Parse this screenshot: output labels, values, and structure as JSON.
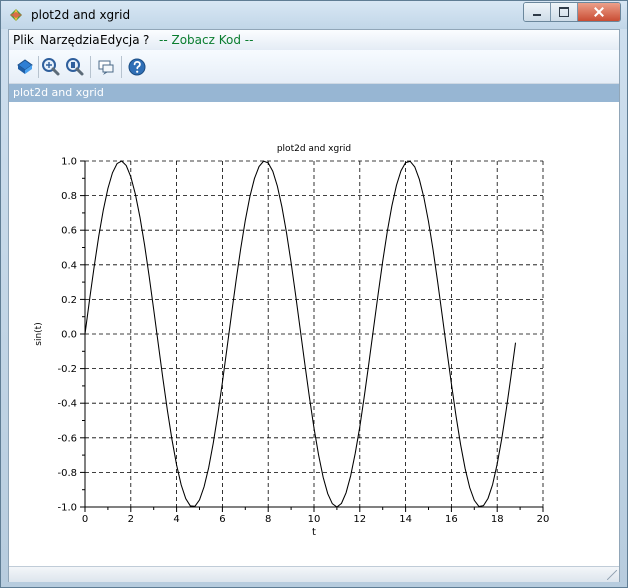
{
  "window": {
    "title": "plot2d and xgrid"
  },
  "menu": {
    "items": [
      {
        "label": "Plik"
      },
      {
        "label": "Narzędzia"
      },
      {
        "label": "Edycja"
      },
      {
        "label": "?"
      },
      {
        "label": "-- Zobacz Kod --"
      }
    ]
  },
  "toolbar": {
    "icons": [
      "rotate-icon",
      "zoom-icon",
      "unzoom-icon",
      "datatip-icon",
      "help-icon"
    ]
  },
  "figure": {
    "title_bar": "plot2d and xgrid"
  },
  "colors": {
    "window_bg": "#cfe0ef",
    "title_bar_accent": "#97b6d3",
    "menu_code_text": "#0a7d2f"
  },
  "chart_data": {
    "type": "line",
    "title": "plot2d and xgrid",
    "xlabel": "t",
    "ylabel": "sin(t)",
    "xlim": [
      0,
      20
    ],
    "ylim": [
      -1.0,
      1.0
    ],
    "xticks": [
      0,
      2,
      4,
      6,
      8,
      10,
      12,
      14,
      16,
      18,
      20
    ],
    "yticks": [
      -1.0,
      -0.8,
      -0.6,
      -0.4,
      -0.2,
      0.0,
      0.2,
      0.4,
      0.6,
      0.8,
      1.0
    ],
    "xtick_labels": [
      "0",
      "2",
      "4",
      "6",
      "8",
      "10",
      "12",
      "14",
      "16",
      "18",
      "20"
    ],
    "ytick_labels": [
      "-1.0",
      "-0.8",
      "-0.6",
      "-0.4",
      "-0.2",
      "0.0",
      "0.2",
      "0.4",
      "0.6",
      "0.8",
      "1.0"
    ],
    "grid": true,
    "series": [
      {
        "x": [
          0.0,
          0.2,
          0.4,
          0.6,
          0.8,
          1.0,
          1.2,
          1.4,
          1.6,
          1.8,
          2.0,
          2.2,
          2.4,
          2.6,
          2.8,
          3.0,
          3.2,
          3.4,
          3.6,
          3.8,
          4.0,
          4.2,
          4.4,
          4.6,
          4.8,
          5.0,
          5.2,
          5.4,
          5.6,
          5.8,
          6.0,
          6.2,
          6.4,
          6.6,
          6.8,
          7.0,
          7.2,
          7.4,
          7.6,
          7.8,
          8.0,
          8.2,
          8.4,
          8.6,
          8.8,
          9.0,
          9.2,
          9.4,
          9.6,
          9.8,
          10.0,
          10.2,
          10.4,
          10.6,
          10.8,
          11.0,
          11.2,
          11.4,
          11.6,
          11.8,
          12.0,
          12.2,
          12.4,
          12.6,
          12.8,
          13.0,
          13.2,
          13.4,
          13.6,
          13.8,
          14.0,
          14.2,
          14.4,
          14.6,
          14.8,
          15.0,
          15.2,
          15.4,
          15.6,
          15.8,
          16.0,
          16.2,
          16.4,
          16.6,
          16.8,
          17.0,
          17.2,
          17.4,
          17.6,
          17.8,
          18.0,
          18.2,
          18.4,
          18.6,
          18.8
        ],
        "y": [
          0.0,
          0.199,
          0.389,
          0.565,
          0.717,
          0.841,
          0.932,
          0.985,
          1.0,
          0.974,
          0.909,
          0.808,
          0.675,
          0.516,
          0.335,
          0.141,
          -0.058,
          -0.256,
          -0.443,
          -0.612,
          -0.757,
          -0.872,
          -0.952,
          -0.994,
          -0.996,
          -0.959,
          -0.883,
          -0.773,
          -0.631,
          -0.465,
          -0.279,
          -0.083,
          0.117,
          0.312,
          0.494,
          0.657,
          0.794,
          0.899,
          0.968,
          0.999,
          0.989,
          0.941,
          0.855,
          0.734,
          0.585,
          0.412,
          0.223,
          0.025,
          -0.174,
          -0.366,
          -0.544,
          -0.699,
          -0.828,
          -0.923,
          -0.981,
          -1.0,
          -0.979,
          -0.918,
          -0.82,
          -0.69,
          -0.537,
          -0.357,
          -0.165,
          0.033,
          0.23,
          0.42,
          0.592,
          0.74,
          0.859,
          0.944,
          0.991,
          0.998,
          0.966,
          0.894,
          0.788,
          0.65,
          0.486,
          0.301,
          0.106,
          -0.093,
          -0.288,
          -0.472,
          -0.638,
          -0.778,
          -0.888,
          -0.961,
          -0.997,
          -0.992,
          -0.95,
          -0.87,
          -0.751,
          -0.604,
          -0.433,
          -0.246,
          -0.05
        ]
      }
    ]
  }
}
